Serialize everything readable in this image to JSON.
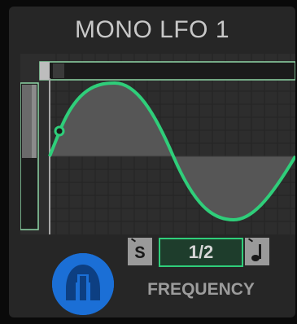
{
  "header": {
    "title": "MONO LFO 1"
  },
  "controls": {
    "sync_label": "S",
    "frequency_value": "1/2",
    "frequency_label": "FREQUENCY"
  },
  "icons": {
    "sync": "sync-mode-icon",
    "note": "note-icon",
    "logo": "plugin-logo-icon"
  },
  "colors": {
    "accent": "#2fce7a",
    "logo_blue": "#1b6fd6",
    "panel": "#262626"
  }
}
